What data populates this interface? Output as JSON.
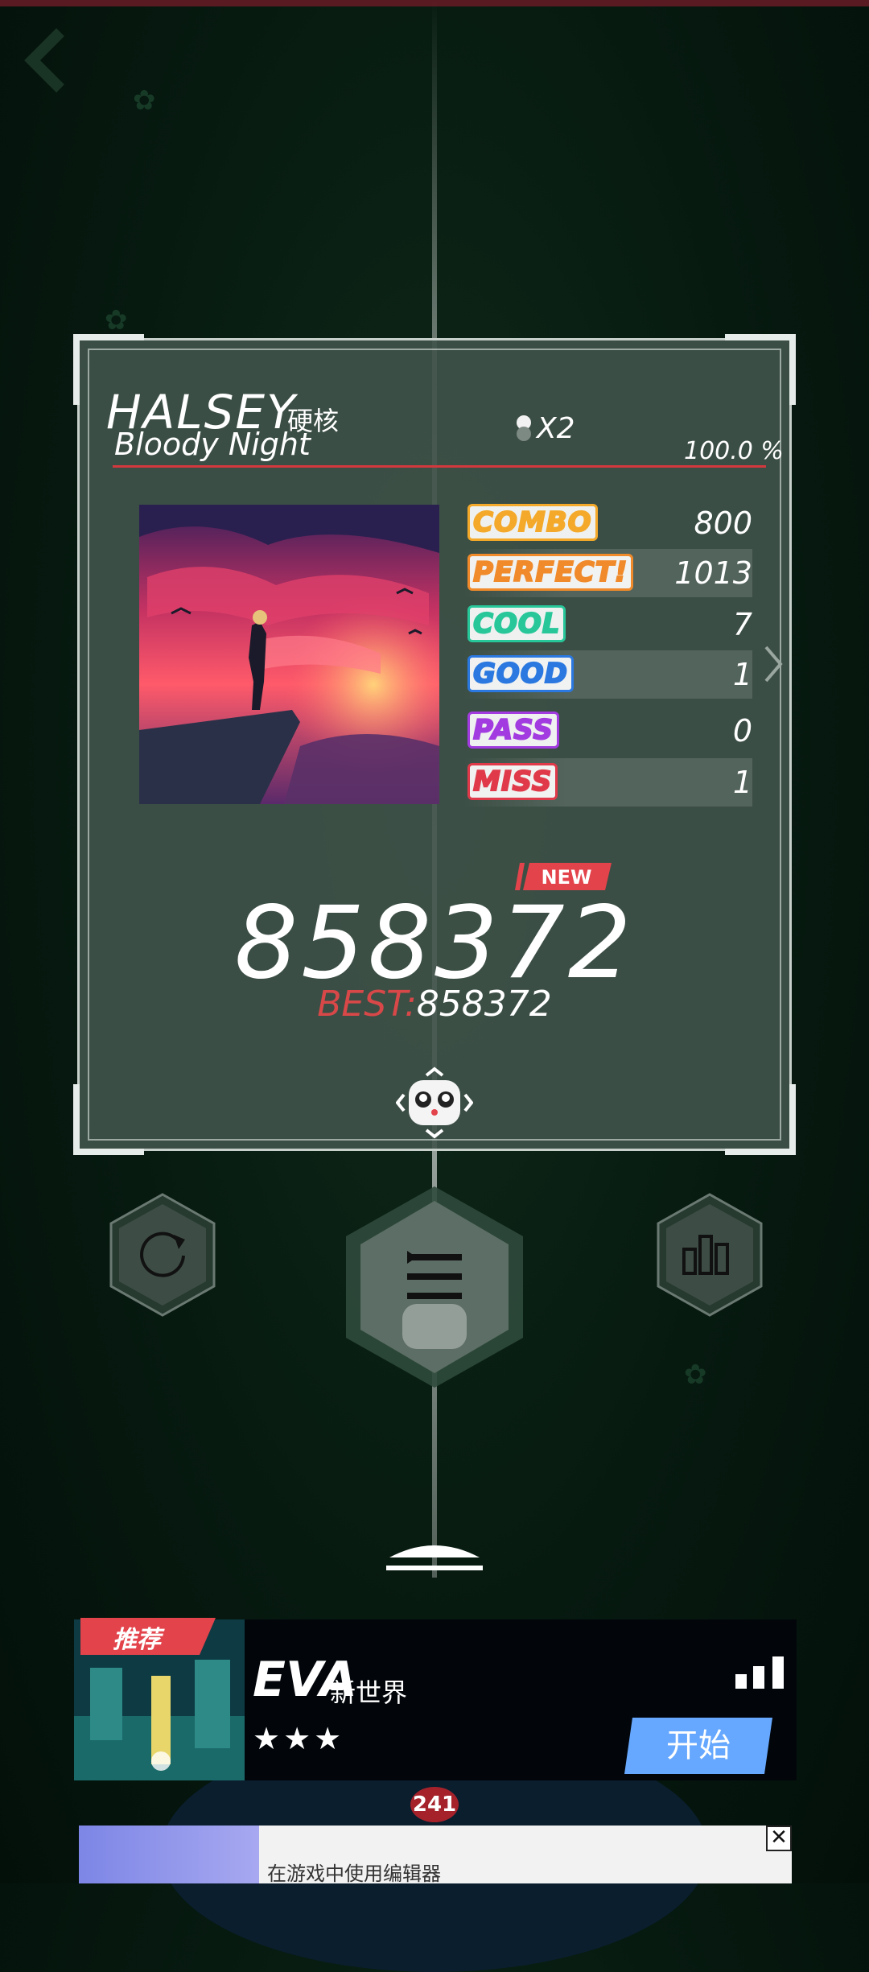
{
  "song": {
    "artist": "HALSEY",
    "genre": "硬核",
    "title": "Bloody Night",
    "multiplier": "X2",
    "accuracy": "100.0 %"
  },
  "stats": [
    {
      "label": "COMBO",
      "value": "800",
      "color": "#f4a92a"
    },
    {
      "label": "PERFECT!",
      "value": "1013",
      "color": "#f08a2a"
    },
    {
      "label": "COOL",
      "value": "7",
      "color": "#28c79a"
    },
    {
      "label": "GOOD",
      "value": "1",
      "color": "#2a78e0"
    },
    {
      "label": "PASS",
      "value": "0",
      "color": "#a23ce0"
    },
    {
      "label": "MISS",
      "value": "1",
      "color": "#e03a4a"
    }
  ],
  "result": {
    "new_badge": "NEW",
    "score": "858372",
    "best_label": "BEST:",
    "best_value": "858372"
  },
  "actions": {
    "retry_icon": "refresh-icon",
    "list_icon": "song-list-icon",
    "rank_icon": "bar-chart-icon"
  },
  "recommend": {
    "tag": "推荐",
    "title": "EVA",
    "subtitle": "新世界",
    "stars": "★★★",
    "start_label": "开始"
  },
  "disc": {
    "number": "241"
  },
  "ad": {
    "text": "在游戏中使用编辑器"
  },
  "colors": {
    "accent_red": "#d3383d",
    "start_blue": "#66a8ff"
  }
}
